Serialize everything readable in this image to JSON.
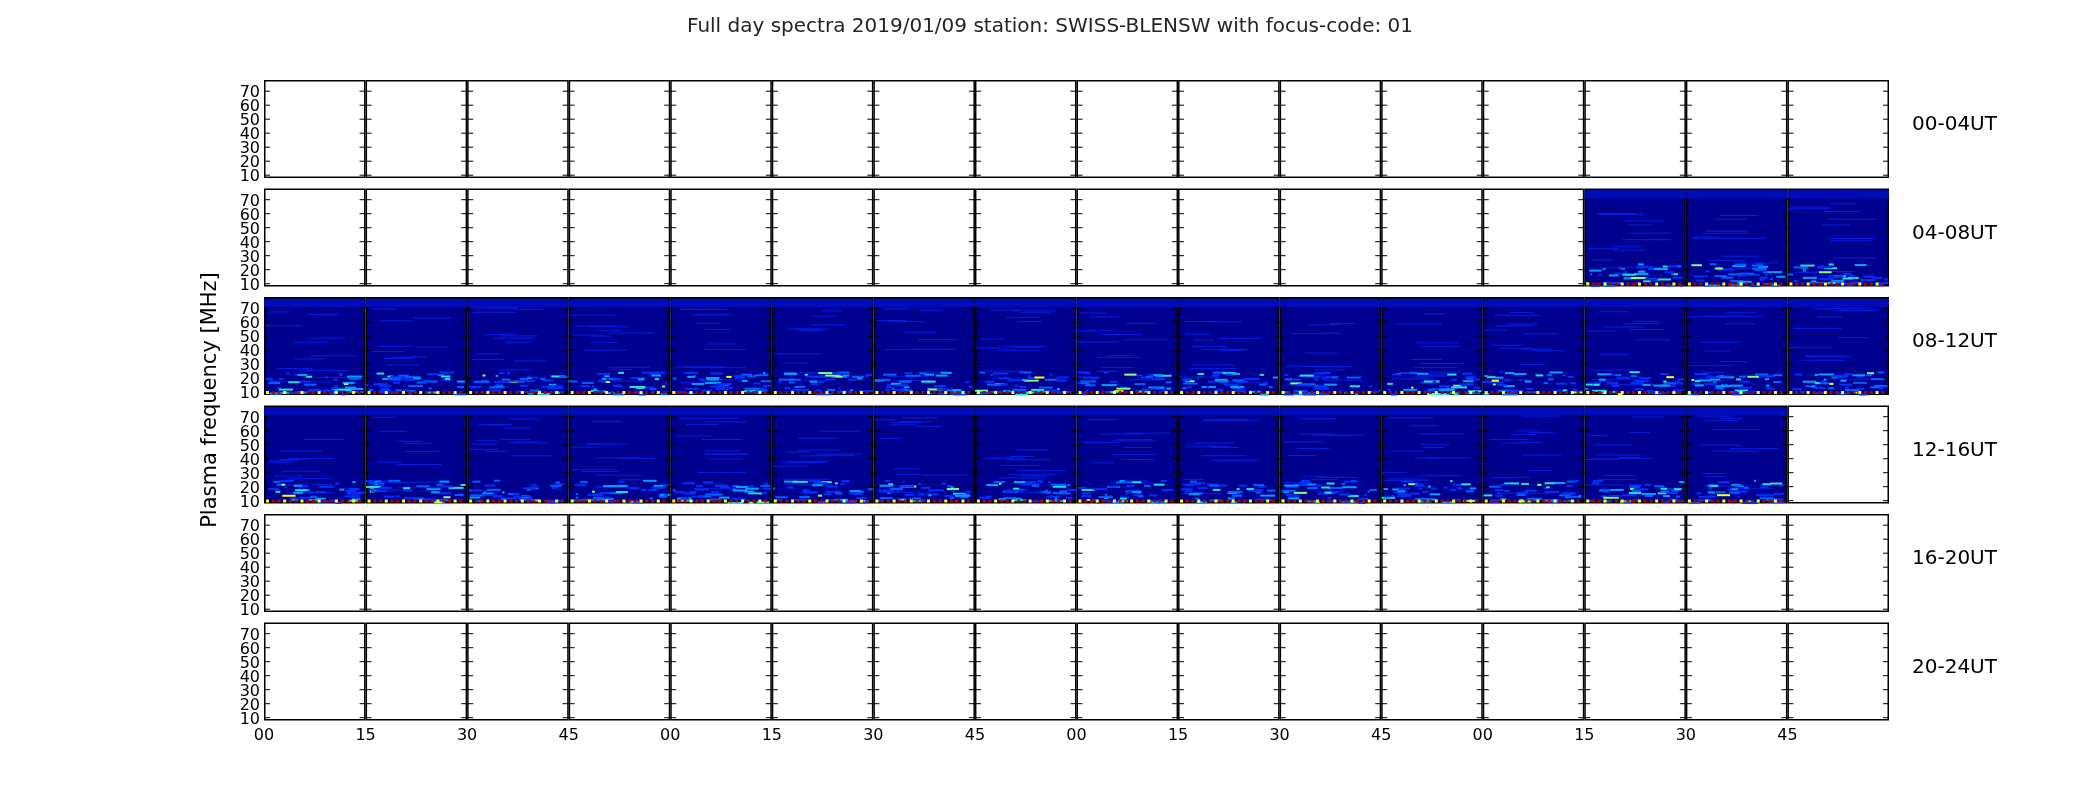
{
  "title": "Full day spectra 2019/01/09 station: SWISS-BLENSW with focus-code: 01",
  "ylabel": "Plasma frequency [MHz]",
  "xticks": [
    "00",
    "15",
    "30",
    "45",
    "00",
    "15",
    "30",
    "45",
    "00",
    "15",
    "30",
    "45",
    "00",
    "15",
    "30",
    "45"
  ],
  "panels": [
    {
      "label": "00-04UT",
      "yticks": [
        "70",
        "60",
        "50",
        "40",
        "30",
        "20",
        "10"
      ],
      "segments": [
        {
          "has_data": false
        },
        {
          "has_data": false
        },
        {
          "has_data": false
        },
        {
          "has_data": false
        },
        {
          "has_data": false
        },
        {
          "has_data": false
        },
        {
          "has_data": false
        },
        {
          "has_data": false
        },
        {
          "has_data": false
        },
        {
          "has_data": false
        },
        {
          "has_data": false
        },
        {
          "has_data": false
        },
        {
          "has_data": false
        },
        {
          "has_data": false
        },
        {
          "has_data": false
        },
        {
          "has_data": false
        }
      ]
    },
    {
      "label": "04-08UT",
      "yticks": [
        "70",
        "60",
        "50",
        "40",
        "30",
        "20",
        "10"
      ],
      "segments": [
        {
          "has_data": false
        },
        {
          "has_data": false
        },
        {
          "has_data": false
        },
        {
          "has_data": false
        },
        {
          "has_data": false
        },
        {
          "has_data": false
        },
        {
          "has_data": false
        },
        {
          "has_data": false
        },
        {
          "has_data": false
        },
        {
          "has_data": false
        },
        {
          "has_data": false
        },
        {
          "has_data": false
        },
        {
          "has_data": false
        },
        {
          "has_data": true
        },
        {
          "has_data": true
        },
        {
          "has_data": true
        }
      ]
    },
    {
      "label": "08-12UT",
      "yticks": [
        "70",
        "60",
        "50",
        "40",
        "30",
        "20",
        "10"
      ],
      "segments": [
        {
          "has_data": true
        },
        {
          "has_data": true
        },
        {
          "has_data": true
        },
        {
          "has_data": true
        },
        {
          "has_data": true
        },
        {
          "has_data": true
        },
        {
          "has_data": true
        },
        {
          "has_data": true
        },
        {
          "has_data": true
        },
        {
          "has_data": true
        },
        {
          "has_data": true
        },
        {
          "has_data": true
        },
        {
          "has_data": true
        },
        {
          "has_data": true
        },
        {
          "has_data": true
        },
        {
          "has_data": true
        }
      ]
    },
    {
      "label": "12-16UT",
      "yticks": [
        "70",
        "60",
        "50",
        "40",
        "30",
        "20",
        "10"
      ],
      "segments": [
        {
          "has_data": true
        },
        {
          "has_data": true
        },
        {
          "has_data": true
        },
        {
          "has_data": true
        },
        {
          "has_data": true
        },
        {
          "has_data": true
        },
        {
          "has_data": true
        },
        {
          "has_data": true
        },
        {
          "has_data": true
        },
        {
          "has_data": true
        },
        {
          "has_data": true
        },
        {
          "has_data": true
        },
        {
          "has_data": true
        },
        {
          "has_data": true
        },
        {
          "has_data": true
        },
        {
          "has_data": false
        }
      ]
    },
    {
      "label": "16-20UT",
      "yticks": [
        "70",
        "60",
        "50",
        "40",
        "30",
        "20",
        "10"
      ],
      "segments": [
        {
          "has_data": false
        },
        {
          "has_data": false
        },
        {
          "has_data": false
        },
        {
          "has_data": false
        },
        {
          "has_data": false
        },
        {
          "has_data": false
        },
        {
          "has_data": false
        },
        {
          "has_data": false
        },
        {
          "has_data": false
        },
        {
          "has_data": false
        },
        {
          "has_data": false
        },
        {
          "has_data": false
        },
        {
          "has_data": false
        },
        {
          "has_data": false
        },
        {
          "has_data": false
        },
        {
          "has_data": false
        }
      ]
    },
    {
      "label": "20-24UT",
      "yticks": [
        "70",
        "60",
        "50",
        "40",
        "30",
        "20",
        "10"
      ],
      "segments": [
        {
          "has_data": false
        },
        {
          "has_data": false
        },
        {
          "has_data": false
        },
        {
          "has_data": false
        },
        {
          "has_data": false
        },
        {
          "has_data": false
        },
        {
          "has_data": false
        },
        {
          "has_data": false
        },
        {
          "has_data": false
        },
        {
          "has_data": false
        },
        {
          "has_data": false
        },
        {
          "has_data": false
        },
        {
          "has_data": false
        },
        {
          "has_data": false
        },
        {
          "has_data": false
        },
        {
          "has_data": false
        }
      ]
    }
  ]
}
